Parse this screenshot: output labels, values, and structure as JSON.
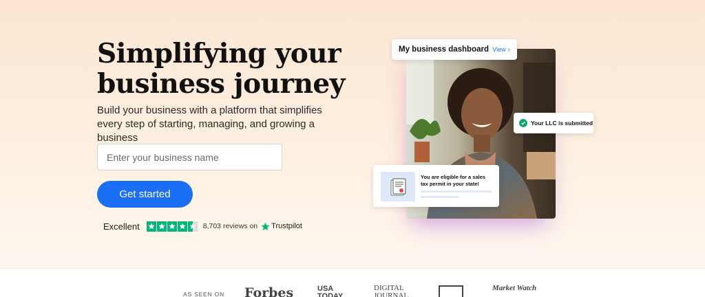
{
  "hero": {
    "title": "Simplifying your business journey",
    "subtitle": "Build your business with a platform that simplifies every step of starting, managing, and growing a business",
    "input_placeholder": "Enter your business name",
    "cta_label": "Get started"
  },
  "trustpilot": {
    "rating_label": "Excellent",
    "stars_rating": 4.5,
    "reviews_text": "8,703 reviews on",
    "brand": "Trustpilot",
    "star_color": "#00b67a"
  },
  "dashboard_card": {
    "title": "My business dashboard",
    "view_label": "View",
    "view_icon": "chevron-right-icon"
  },
  "llc_card": {
    "text": "Your LLC is submitted",
    "icon": "check-circle-icon"
  },
  "tax_card": {
    "text": "You are eligible for a sales tax permit in your state!",
    "icon": "certificate-document-icon"
  },
  "as_seen_on": {
    "label": "AS SEEN ON",
    "logos": [
      "Forbes",
      "USA TODAY",
      "DIGITAL JOURNAL",
      "",
      "Market Watch"
    ]
  },
  "colors": {
    "accent_blue": "#1a6ff5",
    "hero_bg": "#fce6d2",
    "success_green": "#15a46e"
  }
}
